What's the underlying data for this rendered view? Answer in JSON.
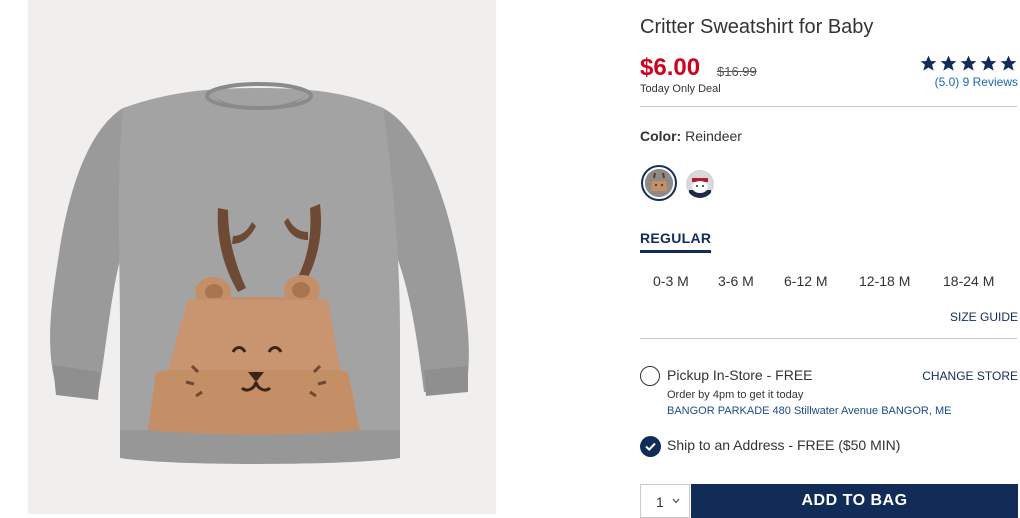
{
  "product": {
    "title": "Critter Sweatshirt for Baby",
    "sale_price": "$6.00",
    "original_price": "$16.99",
    "deal_text": "Today Only Deal",
    "rating": 5,
    "reviews_text": "(5.0) 9 Reviews"
  },
  "color": {
    "label": "Color:",
    "selected": "Reindeer",
    "swatches": [
      "reindeer-swatch",
      "polar-bear-swatch"
    ]
  },
  "size_tab": "REGULAR",
  "sizes": [
    "0-3 M",
    "3-6 M",
    "6-12 M",
    "12-18 M",
    "18-24 M"
  ],
  "size_guide": "SIZE GUIDE",
  "fulfillment": {
    "pickup_label": "Pickup In-Store - FREE",
    "change_store": "CHANGE STORE",
    "order_by": "Order by 4pm to get it today",
    "store_address": "BANGOR PARKADE 480 Stillwater Avenue  BANGOR, ME",
    "ship_label": "Ship to an Address - FREE ($50 MIN)",
    "ship_selected": true
  },
  "cart": {
    "quantity": "1",
    "add_label": "ADD TO BAG"
  },
  "colors": {
    "sale": "#d0021b",
    "navy": "#122c58",
    "link": "#1b66b3"
  }
}
